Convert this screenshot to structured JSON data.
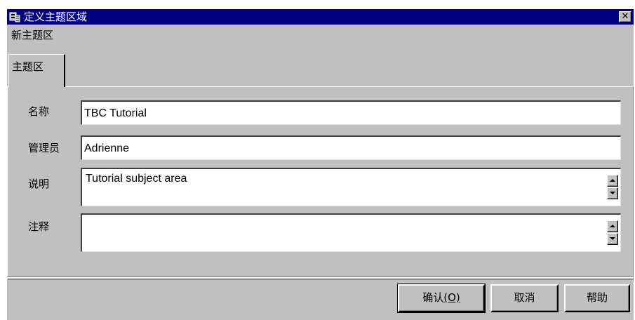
{
  "window": {
    "title": "定义主题区域",
    "close_label": "✕"
  },
  "heading": "新主题区",
  "tabs": [
    {
      "label": "主题区",
      "selected": true
    }
  ],
  "fields": {
    "name": {
      "label": "名称",
      "value": "TBC Tutorial"
    },
    "owner": {
      "label": "管理员",
      "value": "Adrienne"
    },
    "description": {
      "label": "说明",
      "value": "Tutorial subject area"
    },
    "comment": {
      "label": "注释",
      "value": ""
    }
  },
  "buttons": {
    "ok_label": "确认",
    "ok_mnemonic": "(O)",
    "cancel_label": "取消",
    "help_label": "帮助"
  },
  "colors": {
    "titlebar": "#000080",
    "window": "#c0c0c0"
  }
}
